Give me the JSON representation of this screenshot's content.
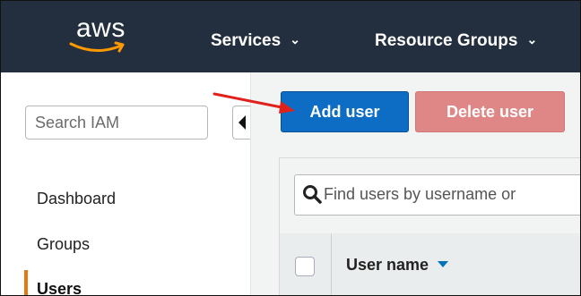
{
  "header": {
    "logo_text": "aws",
    "nav": [
      {
        "label": "Services"
      },
      {
        "label": "Resource Groups"
      }
    ]
  },
  "sidebar": {
    "search_placeholder": "Search IAM",
    "items": [
      {
        "label": "Dashboard"
      },
      {
        "label": "Groups"
      },
      {
        "label": "Users",
        "active": true
      }
    ]
  },
  "main": {
    "add_user_label": "Add user",
    "delete_user_label": "Delete user",
    "filter_placeholder": "Find users by username or",
    "table": {
      "columns": [
        {
          "label": "User name"
        }
      ]
    }
  },
  "colors": {
    "topbar": "#232f3e",
    "primary_button": "#0d6dc4",
    "delete_button_disabled": "#df8787",
    "active_marker": "#e47911",
    "annotation_arrow": "#e0201b"
  },
  "icons": {
    "logo": "aws-smile-logo",
    "search": "magnifier-icon",
    "collapse": "triangle-left-icon",
    "sort": "sort-down-caret-icon",
    "nav_dropdown": "chevron-down-icon"
  }
}
